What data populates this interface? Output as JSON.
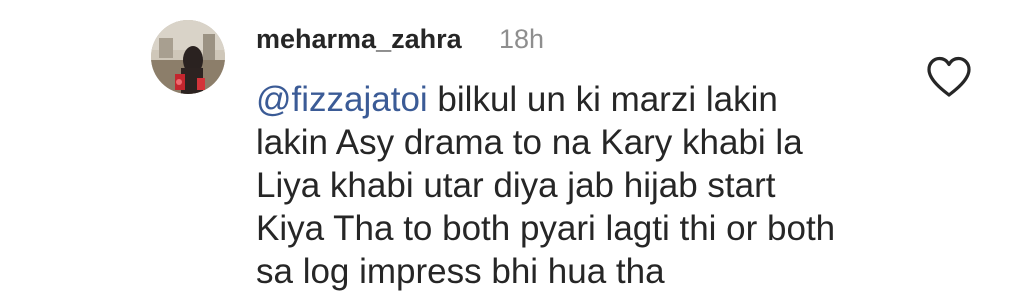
{
  "comment": {
    "username": "meharma_zahra",
    "timestamp": "18h",
    "mention": "@fizzajatoi",
    "lines": [
      " bilkul un ki marzi lakin",
      "lakin Asy drama to na Kary khabi la",
      "Liya khabi utar diya jab hijab start",
      "Kiya Tha to both pyari lagti thi or both",
      "sa log impress bhi hua tha"
    ],
    "icons": {
      "avatar": "avatar-image",
      "like": "heart-outline-icon"
    }
  }
}
